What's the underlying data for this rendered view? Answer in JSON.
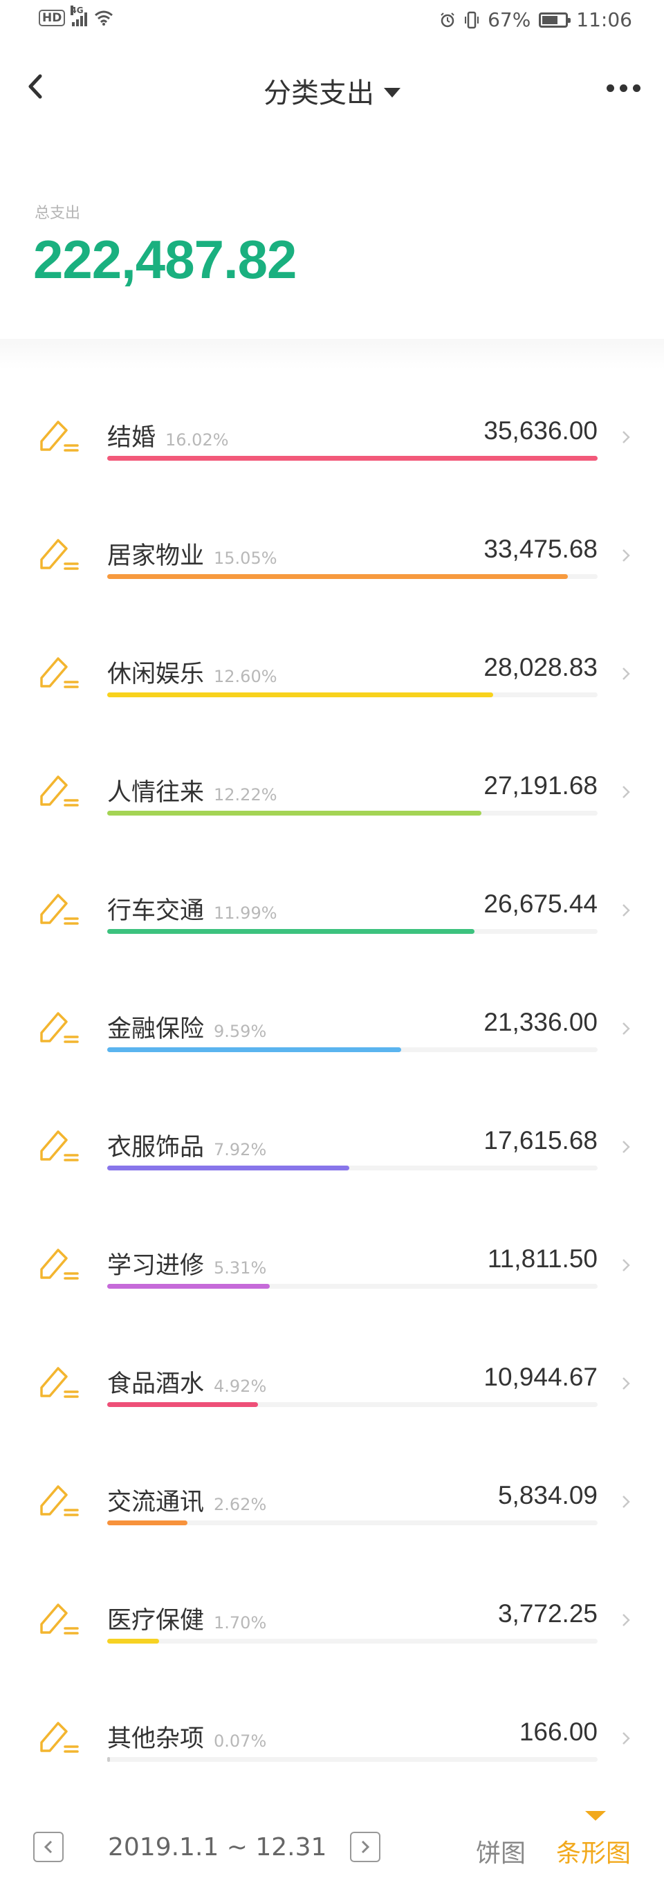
{
  "status_bar": {
    "network": "4G",
    "hd": "HD",
    "battery": "67%",
    "time": "11:06"
  },
  "header": {
    "title": "分类支出"
  },
  "summary": {
    "label": "总支出",
    "total": "222,487.82"
  },
  "categories": [
    {
      "name": "结婚",
      "pct": "16.02%",
      "amount": "35,636.00",
      "fraction": 1.0,
      "color": "#f2597a"
    },
    {
      "name": "居家物业",
      "pct": "15.05%",
      "amount": "33,475.68",
      "fraction": 0.939,
      "color": "#f79a3e"
    },
    {
      "name": "休闲娱乐",
      "pct": "12.60%",
      "amount": "28,028.83",
      "fraction": 0.787,
      "color": "#f8d21d"
    },
    {
      "name": "人情往来",
      "pct": "12.22%",
      "amount": "27,191.68",
      "fraction": 0.763,
      "color": "#a4d454"
    },
    {
      "name": "行车交通",
      "pct": "11.99%",
      "amount": "26,675.44",
      "fraction": 0.749,
      "color": "#3cc27e"
    },
    {
      "name": "金融保险",
      "pct": "9.59%",
      "amount": "21,336.00",
      "fraction": 0.599,
      "color": "#5ab4ef"
    },
    {
      "name": "衣服饰品",
      "pct": "7.92%",
      "amount": "17,615.68",
      "fraction": 0.494,
      "color": "#8876ea"
    },
    {
      "name": "学习进修",
      "pct": "5.31%",
      "amount": "11,811.50",
      "fraction": 0.331,
      "color": "#c66ad9"
    },
    {
      "name": "食品酒水",
      "pct": "4.92%",
      "amount": "10,944.67",
      "fraction": 0.307,
      "color": "#ee4f78"
    },
    {
      "name": "交流通讯",
      "pct": "2.62%",
      "amount": "5,834.09",
      "fraction": 0.164,
      "color": "#f7923c"
    },
    {
      "name": "医疗保健",
      "pct": "1.70%",
      "amount": "3,772.25",
      "fraction": 0.106,
      "color": "#f6d224"
    },
    {
      "name": "其他杂项",
      "pct": "0.07%",
      "amount": "166.00",
      "fraction": 0.005,
      "color": "#cccccc"
    }
  ],
  "icon_color": "#f3b52f",
  "footer": {
    "date_range": "2019.1.1 ~ 12.31",
    "tab_pie": "饼图",
    "tab_bar": "条形图",
    "active_tab": "条形图"
  }
}
